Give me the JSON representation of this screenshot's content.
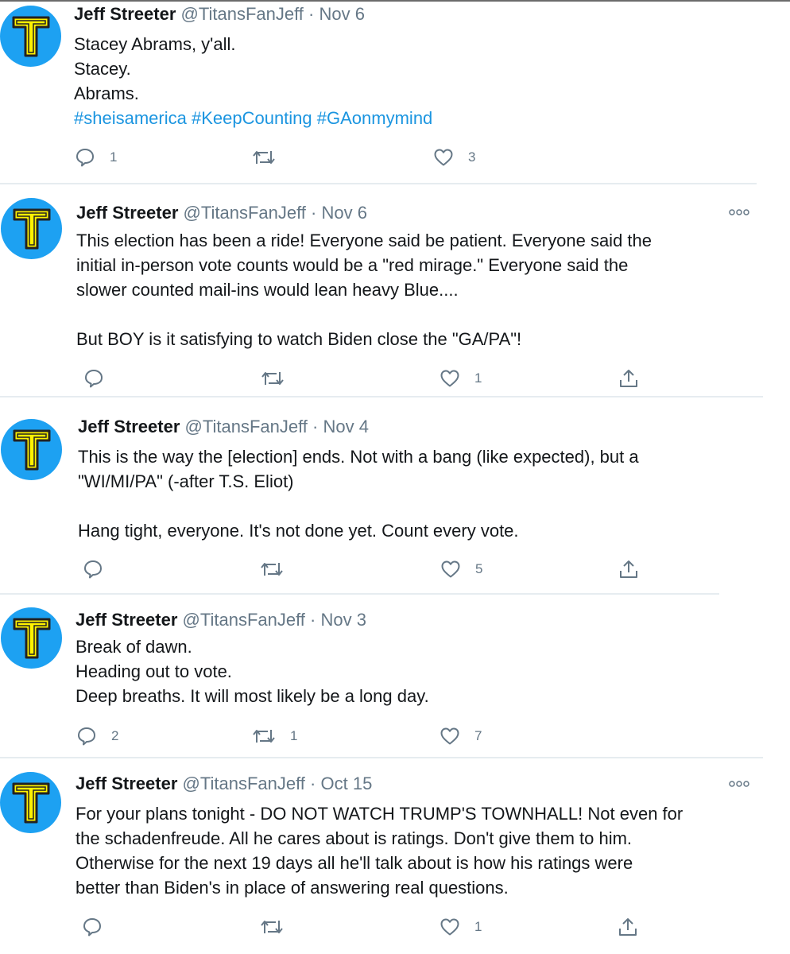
{
  "colors": {
    "avatar_bg": "#1da1f2",
    "avatar_letter": "#fff200",
    "link": "#1b95e0",
    "muted": "#657786",
    "divider": "#e6ecf0"
  },
  "tweets": [
    {
      "name": "Jeff Streeter",
      "handle": "@TitansFanJeff",
      "separator": "·",
      "date": "Nov 6",
      "avatar_letter": "T",
      "lines": [
        "Stacey Abrams, y'all.",
        "Stacey.",
        "Abrams."
      ],
      "hashtags": [
        "#sheisamerica",
        "#KeepCounting",
        "#GAonmymind"
      ],
      "reply_count": "1",
      "retweet_count": "",
      "like_count": "3",
      "icons": [
        "reply-icon",
        "retweet-icon",
        "like-icon"
      ]
    },
    {
      "name": "Jeff Streeter",
      "handle": "@TitansFanJeff",
      "separator": "·",
      "date": "Nov 6",
      "avatar_letter": "T",
      "lines": [
        "This election has been a ride! Everyone said be patient. Everyone said the",
        "initial in-person vote counts would be a \"red mirage.\" Everyone said the",
        "slower counted mail-ins would lean heavy Blue....",
        "",
        "But BOY is it satisfying to watch Biden close the \"GA/PA\"!"
      ],
      "reply_count": "",
      "retweet_count": "",
      "like_count": "1",
      "icons": [
        "more-icon",
        "reply-icon",
        "retweet-icon",
        "like-icon",
        "share-icon"
      ]
    },
    {
      "name": "Jeff Streeter",
      "handle": "@TitansFanJeff",
      "separator": "·",
      "date": "Nov 4",
      "avatar_letter": "T",
      "lines": [
        "This is the way the [election] ends. Not with a bang (like expected), but a",
        "\"WI/MI/PA\" (-after T.S. Eliot)",
        "",
        "Hang tight, everyone. It's not done yet. Count every vote."
      ],
      "reply_count": "",
      "retweet_count": "",
      "like_count": "5",
      "icons": [
        "reply-icon",
        "retweet-icon",
        "like-icon",
        "share-icon"
      ]
    },
    {
      "name": "Jeff Streeter",
      "handle": "@TitansFanJeff",
      "separator": "·",
      "date": "Nov 3",
      "avatar_letter": "T",
      "lines": [
        "Break of dawn.",
        "Heading out to vote.",
        "Deep breaths. It will most likely be a long day."
      ],
      "reply_count": "2",
      "retweet_count": "1",
      "like_count": "7",
      "icons": [
        "reply-icon",
        "retweet-icon",
        "like-icon"
      ]
    },
    {
      "name": "Jeff Streeter",
      "handle": "@TitansFanJeff",
      "separator": "·",
      "date": "Oct 15",
      "avatar_letter": "T",
      "lines": [
        "For your plans tonight - DO NOT WATCH TRUMP'S TOWNHALL! Not even for",
        "the schadenfreude. All he cares about is ratings. Don't give them to him.",
        "Otherwise for the next 19 days all he'll talk about is how his ratings were",
        "better than Biden's in place of answering real questions."
      ],
      "reply_count": "",
      "retweet_count": "",
      "like_count": "1",
      "icons": [
        "more-icon",
        "reply-icon",
        "retweet-icon",
        "like-icon",
        "share-icon"
      ]
    }
  ]
}
